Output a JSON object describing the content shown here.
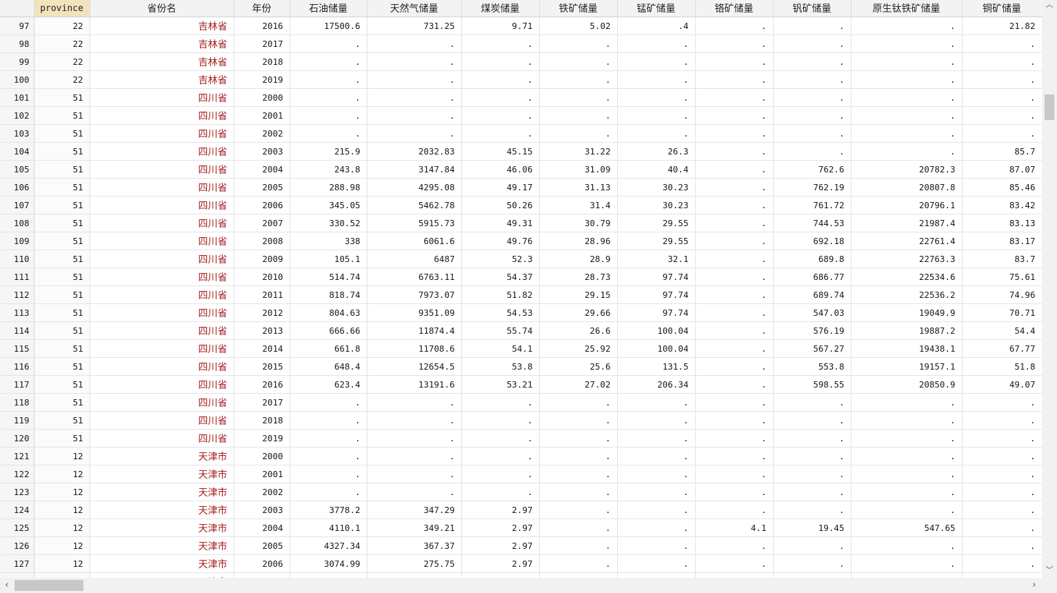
{
  "columns": [
    "",
    "province",
    "省份名",
    "年份",
    "石油储量",
    "天然气储量",
    "煤炭储量",
    "铁矿储量",
    "锰矿储量",
    "铬矿储量",
    "钒矿储量",
    "原生钛铁矿储量",
    "铜矿储量"
  ],
  "selected_column": "province",
  "rows": [
    [
      "97",
      "22",
      "吉林省",
      "2016",
      "17500.6",
      "731.25",
      "9.71",
      "5.02",
      ".4",
      ".",
      ".",
      ".",
      "21.82"
    ],
    [
      "98",
      "22",
      "吉林省",
      "2017",
      ".",
      ".",
      ".",
      ".",
      ".",
      ".",
      ".",
      ".",
      "."
    ],
    [
      "99",
      "22",
      "吉林省",
      "2018",
      ".",
      ".",
      ".",
      ".",
      ".",
      ".",
      ".",
      ".",
      "."
    ],
    [
      "100",
      "22",
      "吉林省",
      "2019",
      ".",
      ".",
      ".",
      ".",
      ".",
      ".",
      ".",
      ".",
      "."
    ],
    [
      "101",
      "51",
      "四川省",
      "2000",
      ".",
      ".",
      ".",
      ".",
      ".",
      ".",
      ".",
      ".",
      "."
    ],
    [
      "102",
      "51",
      "四川省",
      "2001",
      ".",
      ".",
      ".",
      ".",
      ".",
      ".",
      ".",
      ".",
      "."
    ],
    [
      "103",
      "51",
      "四川省",
      "2002",
      ".",
      ".",
      ".",
      ".",
      ".",
      ".",
      ".",
      ".",
      "."
    ],
    [
      "104",
      "51",
      "四川省",
      "2003",
      "215.9",
      "2032.83",
      "45.15",
      "31.22",
      "26.3",
      ".",
      ".",
      ".",
      "85.7"
    ],
    [
      "105",
      "51",
      "四川省",
      "2004",
      "243.8",
      "3147.84",
      "46.06",
      "31.09",
      "40.4",
      ".",
      "762.6",
      "20782.3",
      "87.07"
    ],
    [
      "106",
      "51",
      "四川省",
      "2005",
      "288.98",
      "4295.08",
      "49.17",
      "31.13",
      "30.23",
      ".",
      "762.19",
      "20807.8",
      "85.46"
    ],
    [
      "107",
      "51",
      "四川省",
      "2006",
      "345.05",
      "5462.78",
      "50.26",
      "31.4",
      "30.23",
      ".",
      "761.72",
      "20796.1",
      "83.42"
    ],
    [
      "108",
      "51",
      "四川省",
      "2007",
      "330.52",
      "5915.73",
      "49.31",
      "30.79",
      "29.55",
      ".",
      "744.53",
      "21987.4",
      "83.13"
    ],
    [
      "109",
      "51",
      "四川省",
      "2008",
      "338",
      "6061.6",
      "49.76",
      "28.96",
      "29.55",
      ".",
      "692.18",
      "22761.4",
      "83.17"
    ],
    [
      "110",
      "51",
      "四川省",
      "2009",
      "105.1",
      "6487",
      "52.3",
      "28.9",
      "32.1",
      ".",
      "689.8",
      "22763.3",
      "83.7"
    ],
    [
      "111",
      "51",
      "四川省",
      "2010",
      "514.74",
      "6763.11",
      "54.37",
      "28.73",
      "97.74",
      ".",
      "686.77",
      "22534.6",
      "75.61"
    ],
    [
      "112",
      "51",
      "四川省",
      "2011",
      "818.74",
      "7973.07",
      "51.82",
      "29.15",
      "97.74",
      ".",
      "689.74",
      "22536.2",
      "74.96"
    ],
    [
      "113",
      "51",
      "四川省",
      "2012",
      "804.63",
      "9351.09",
      "54.53",
      "29.66",
      "97.74",
      ".",
      "547.03",
      "19049.9",
      "70.71"
    ],
    [
      "114",
      "51",
      "四川省",
      "2013",
      "666.66",
      "11874.4",
      "55.74",
      "26.6",
      "100.04",
      ".",
      "576.19",
      "19887.2",
      "54.4"
    ],
    [
      "115",
      "51",
      "四川省",
      "2014",
      "661.8",
      "11708.6",
      "54.1",
      "25.92",
      "100.04",
      ".",
      "567.27",
      "19438.1",
      "67.77"
    ],
    [
      "116",
      "51",
      "四川省",
      "2015",
      "648.4",
      "12654.5",
      "53.8",
      "25.6",
      "131.5",
      ".",
      "553.8",
      "19157.1",
      "51.8"
    ],
    [
      "117",
      "51",
      "四川省",
      "2016",
      "623.4",
      "13191.6",
      "53.21",
      "27.02",
      "206.34",
      ".",
      "598.55",
      "20850.9",
      "49.07"
    ],
    [
      "118",
      "51",
      "四川省",
      "2017",
      ".",
      ".",
      ".",
      ".",
      ".",
      ".",
      ".",
      ".",
      "."
    ],
    [
      "119",
      "51",
      "四川省",
      "2018",
      ".",
      ".",
      ".",
      ".",
      ".",
      ".",
      ".",
      ".",
      "."
    ],
    [
      "120",
      "51",
      "四川省",
      "2019",
      ".",
      ".",
      ".",
      ".",
      ".",
      ".",
      ".",
      ".",
      "."
    ],
    [
      "121",
      "12",
      "天津市",
      "2000",
      ".",
      ".",
      ".",
      ".",
      ".",
      ".",
      ".",
      ".",
      "."
    ],
    [
      "122",
      "12",
      "天津市",
      "2001",
      ".",
      ".",
      ".",
      ".",
      ".",
      ".",
      ".",
      ".",
      "."
    ],
    [
      "123",
      "12",
      "天津市",
      "2002",
      ".",
      ".",
      ".",
      ".",
      ".",
      ".",
      ".",
      ".",
      "."
    ],
    [
      "124",
      "12",
      "天津市",
      "2003",
      "3778.2",
      "347.29",
      "2.97",
      ".",
      ".",
      ".",
      ".",
      ".",
      "."
    ],
    [
      "125",
      "12",
      "天津市",
      "2004",
      "4110.1",
      "349.21",
      "2.97",
      ".",
      ".",
      "4.1",
      "19.45",
      "547.65",
      "."
    ],
    [
      "126",
      "12",
      "天津市",
      "2005",
      "4327.34",
      "367.37",
      "2.97",
      ".",
      ".",
      ".",
      ".",
      ".",
      "."
    ],
    [
      "127",
      "12",
      "天津市",
      "2006",
      "3074.99",
      "275.75",
      "2.97",
      ".",
      ".",
      ".",
      ".",
      ".",
      "."
    ],
    [
      "",
      "",
      "天津市",
      "",
      "",
      "",
      "",
      "",
      "",
      "",
      "",
      "",
      ""
    ]
  ],
  "scrollbars": {
    "up_glyph": "︿",
    "down_glyph": "﹀",
    "left_glyph": "‹",
    "right_glyph": "›"
  },
  "colors": {
    "header_bg": "#f3f3f3",
    "selected_header_bg": "#f2e3bd",
    "name_text": "#a41d1d",
    "grid": "#e3e3e3"
  }
}
